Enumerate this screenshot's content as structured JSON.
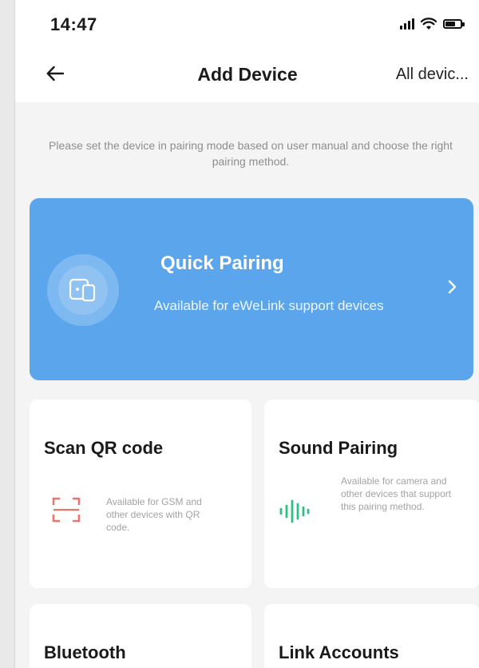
{
  "status_bar": {
    "time": "14:47",
    "battery_level": 0.7
  },
  "nav": {
    "title": "Add Device",
    "right_link": "All devic..."
  },
  "instructions": "Please set the device in pairing mode based on user manual and choose the right pairing method.",
  "quick_pairing": {
    "title": "Quick Pairing",
    "description": "Available for eWeLink support devices",
    "color": "#5aa5ec"
  },
  "methods": {
    "scan_qr": {
      "title": "Scan QR code",
      "description": "Available for GSM and other devices with QR code.",
      "icon": "qr-scan-icon",
      "icon_color": "#e8776b"
    },
    "sound": {
      "title": "Sound Pairing",
      "description": "Available for camera and other devices that support this pairing method.",
      "icon": "sound-wave-icon",
      "icon_color": "#2fbf83"
    },
    "bluetooth": {
      "title": "Bluetooth"
    },
    "link_accounts": {
      "title": "Link Accounts"
    }
  }
}
